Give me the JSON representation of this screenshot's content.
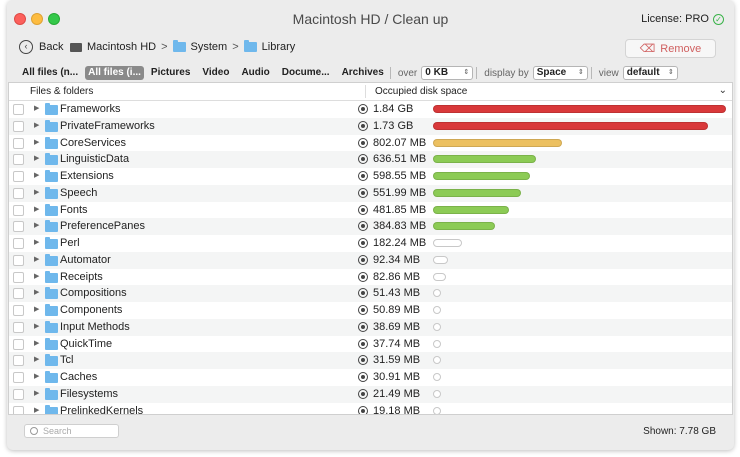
{
  "window": {
    "title": "Macintosh HD / Clean up",
    "license": "License: PRO"
  },
  "nav": {
    "back_label": "Back",
    "breadcrumbs": [
      "Macintosh HD",
      "System",
      "Library"
    ],
    "remove_label": "Remove"
  },
  "filters": {
    "tabs": [
      "All files (n...",
      "All files (i...",
      "Pictures",
      "Video",
      "Audio",
      "Docume...",
      "Archives"
    ],
    "active_tab": 1,
    "over_label": "over",
    "over_value": "0 KB",
    "display_by_label": "display by",
    "display_by_value": "Space",
    "view_label": "view",
    "view_value": "default"
  },
  "table": {
    "col_name": "Files & folders",
    "col_size": "Occupied disk space",
    "rows": [
      {
        "name": "Frameworks",
        "size": "1.84 GB",
        "fraction": 1.0,
        "color": "#d9383a"
      },
      {
        "name": "PrivateFrameworks",
        "size": "1.73 GB",
        "fraction": 0.94,
        "color": "#d9383a"
      },
      {
        "name": "CoreServices",
        "size": "802.07 MB",
        "fraction": 0.44,
        "color": "#ecc060"
      },
      {
        "name": "LinguisticData",
        "size": "636.51 MB",
        "fraction": 0.35,
        "color": "#8ccb55"
      },
      {
        "name": "Extensions",
        "size": "598.55 MB",
        "fraction": 0.33,
        "color": "#8ccb55"
      },
      {
        "name": "Speech",
        "size": "551.99 MB",
        "fraction": 0.3,
        "color": "#8ccb55"
      },
      {
        "name": "Fonts",
        "size": "481.85 MB",
        "fraction": 0.26,
        "color": "#8ccb55"
      },
      {
        "name": "PreferencePanes",
        "size": "384.83 MB",
        "fraction": 0.21,
        "color": "#8ccb55"
      },
      {
        "name": "Perl",
        "size": "182.24 MB",
        "fraction": 0.1,
        "color": "#ffffff"
      },
      {
        "name": "Automator",
        "size": "92.34 MB",
        "fraction": 0.05,
        "color": "#ffffff"
      },
      {
        "name": "Receipts",
        "size": "82.86 MB",
        "fraction": 0.045,
        "color": "#ffffff"
      },
      {
        "name": "Compositions",
        "size": "51.43 MB",
        "fraction": 0.028,
        "color": "#ffffff"
      },
      {
        "name": "Components",
        "size": "50.89 MB",
        "fraction": 0.028,
        "color": "#ffffff"
      },
      {
        "name": "Input Methods",
        "size": "38.69 MB",
        "fraction": 0.021,
        "color": "#ffffff"
      },
      {
        "name": "QuickTime",
        "size": "37.74 MB",
        "fraction": 0.02,
        "color": "#ffffff"
      },
      {
        "name": "Tcl",
        "size": "31.59 MB",
        "fraction": 0.017,
        "color": "#ffffff"
      },
      {
        "name": "Caches",
        "size": "30.91 MB",
        "fraction": 0.017,
        "color": "#ffffff"
      },
      {
        "name": "Filesystems",
        "size": "21.49 MB",
        "fraction": 0.012,
        "color": "#ffffff"
      },
      {
        "name": "PrelinkedKernels",
        "size": "19.18 MB",
        "fraction": 0.01,
        "color": "#ffffff"
      }
    ]
  },
  "status": {
    "search_placeholder": "Search",
    "shown": "Shown: 7.78 GB"
  }
}
